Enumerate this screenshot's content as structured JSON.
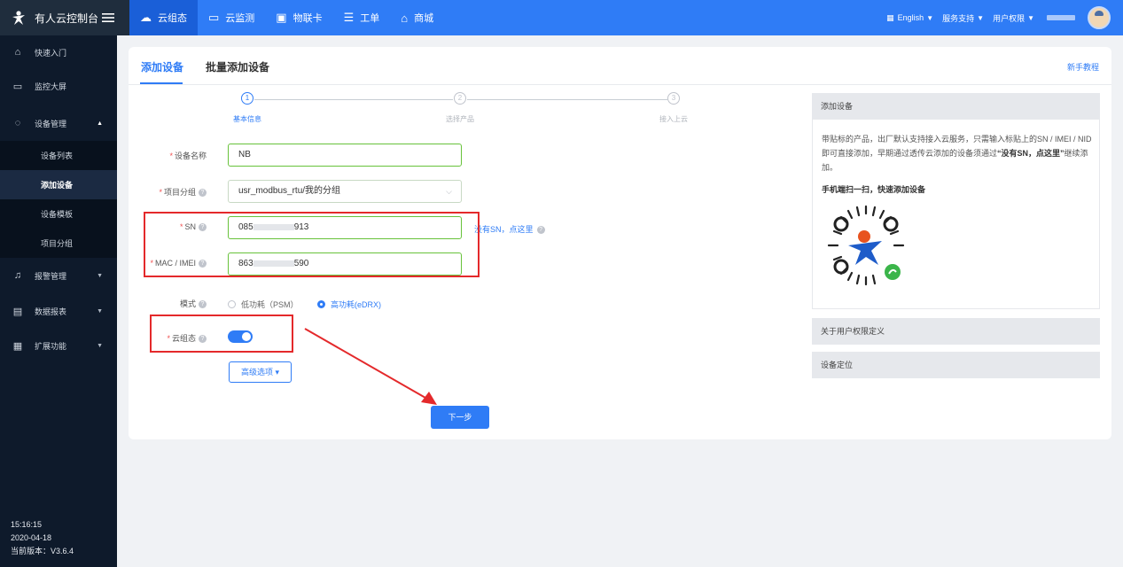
{
  "topbar": {
    "brand": "有人云控制台",
    "nav": [
      {
        "label": "云组态",
        "icon": "cloud-icon",
        "active": true
      },
      {
        "label": "云监测",
        "icon": "monitor-icon",
        "active": false
      },
      {
        "label": "物联卡",
        "icon": "sim-card-icon",
        "active": false
      },
      {
        "label": "工单",
        "icon": "ticket-icon",
        "active": false
      },
      {
        "label": "商城",
        "icon": "shop-icon",
        "active": false
      }
    ],
    "language": "English",
    "support": "服务支持",
    "permission": "用户权限"
  },
  "sidebar": {
    "items": [
      {
        "label": "快速入门",
        "icon": "home-icon"
      },
      {
        "label": "监控大屏",
        "icon": "screen-icon"
      },
      {
        "label": "设备管理",
        "icon": "device-icon"
      }
    ],
    "sub_items": [
      {
        "label": "设备列表"
      },
      {
        "label": "添加设备",
        "active": true
      },
      {
        "label": "设备模板"
      },
      {
        "label": "项目分组"
      }
    ],
    "items_after": [
      {
        "label": "报警管理",
        "icon": "bell-icon"
      },
      {
        "label": "数据报表",
        "icon": "report-icon"
      },
      {
        "label": "扩展功能",
        "icon": "grid-icon"
      }
    ],
    "time": "15:16:15",
    "date": "2020-04-18",
    "version": "当前版本：V3.6.4"
  },
  "tabs": {
    "add": "添加设备",
    "batch": "批量添加设备",
    "help": "新手教程"
  },
  "steps": [
    {
      "num": "1",
      "label": "基本信息"
    },
    {
      "num": "2",
      "label": "选择产品"
    },
    {
      "num": "3",
      "label": "接入上云"
    }
  ],
  "form": {
    "name_label": "设备名称",
    "name_value": "NB",
    "group_label": "项目分组",
    "group_value": "usr_modbus_rtu/我的分组",
    "sn_label": "SN",
    "sn_prefix": "085",
    "sn_suffix": "913",
    "sn_link": "没有SN，点这里",
    "mac_label": "MAC / IMEI",
    "mac_prefix": "863",
    "mac_suffix": "590",
    "mode_label": "模式",
    "mode_low": "低功耗（PSM）",
    "mode_high": "高功耗(eDRX)",
    "cloud_label": "云组态",
    "advanced": "高级选项",
    "next": "下一步"
  },
  "panel": {
    "title": "添加设备",
    "text_a": "带贴标的产品，出厂默认支持接入云服务，只需输入标贴上的SN / IMEI / NID 即可直接添加，早期通过透传云添加的设备须通过",
    "text_bold": "“没有SN，点这里”",
    "text_b": "继续添加。",
    "scan": "手机端扫一扫，快速添加设备",
    "about": "关于用户权限定义",
    "locate": "设备定位"
  }
}
